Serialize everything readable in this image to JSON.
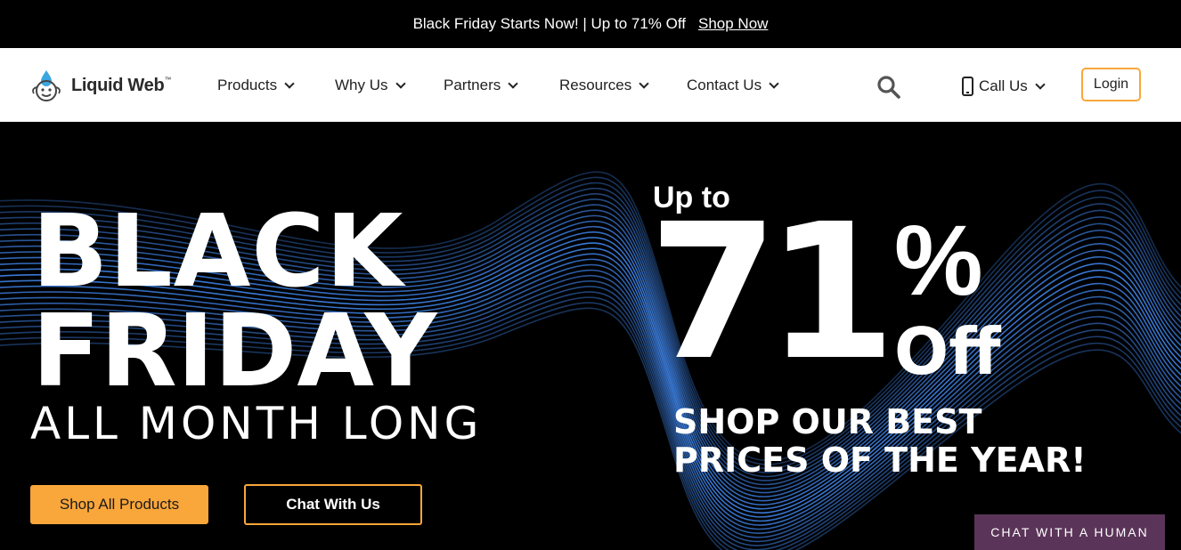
{
  "promo": {
    "text": "Black Friday Starts Now! | Up to 71% Off",
    "link": "Shop Now"
  },
  "header": {
    "logo_text": "Liquid Web",
    "logo_tm": "™",
    "nav": [
      {
        "label": "Products"
      },
      {
        "label": "Why Us"
      },
      {
        "label": "Partners"
      },
      {
        "label": "Resources"
      },
      {
        "label": "Contact Us"
      }
    ],
    "call_label": "Call Us",
    "login_label": "Login"
  },
  "hero": {
    "line1": "BLACK",
    "line2": "FRIDAY",
    "line3": "ALL MONTH LONG",
    "upto": "Up to",
    "big_number": "71",
    "percent": "%",
    "off": "Off",
    "tagline1": "SHOP OUR BEST",
    "tagline2": "PRICES OF THE YEAR!",
    "btn_shop": "Shop All Products",
    "btn_chat": "Chat With Us"
  },
  "chat_widget": {
    "label": "CHAT WITH A HUMAN"
  },
  "colors": {
    "accent": "#f9a63b",
    "wave": "#3d7fe0",
    "chat_widget": "#5b3459"
  }
}
